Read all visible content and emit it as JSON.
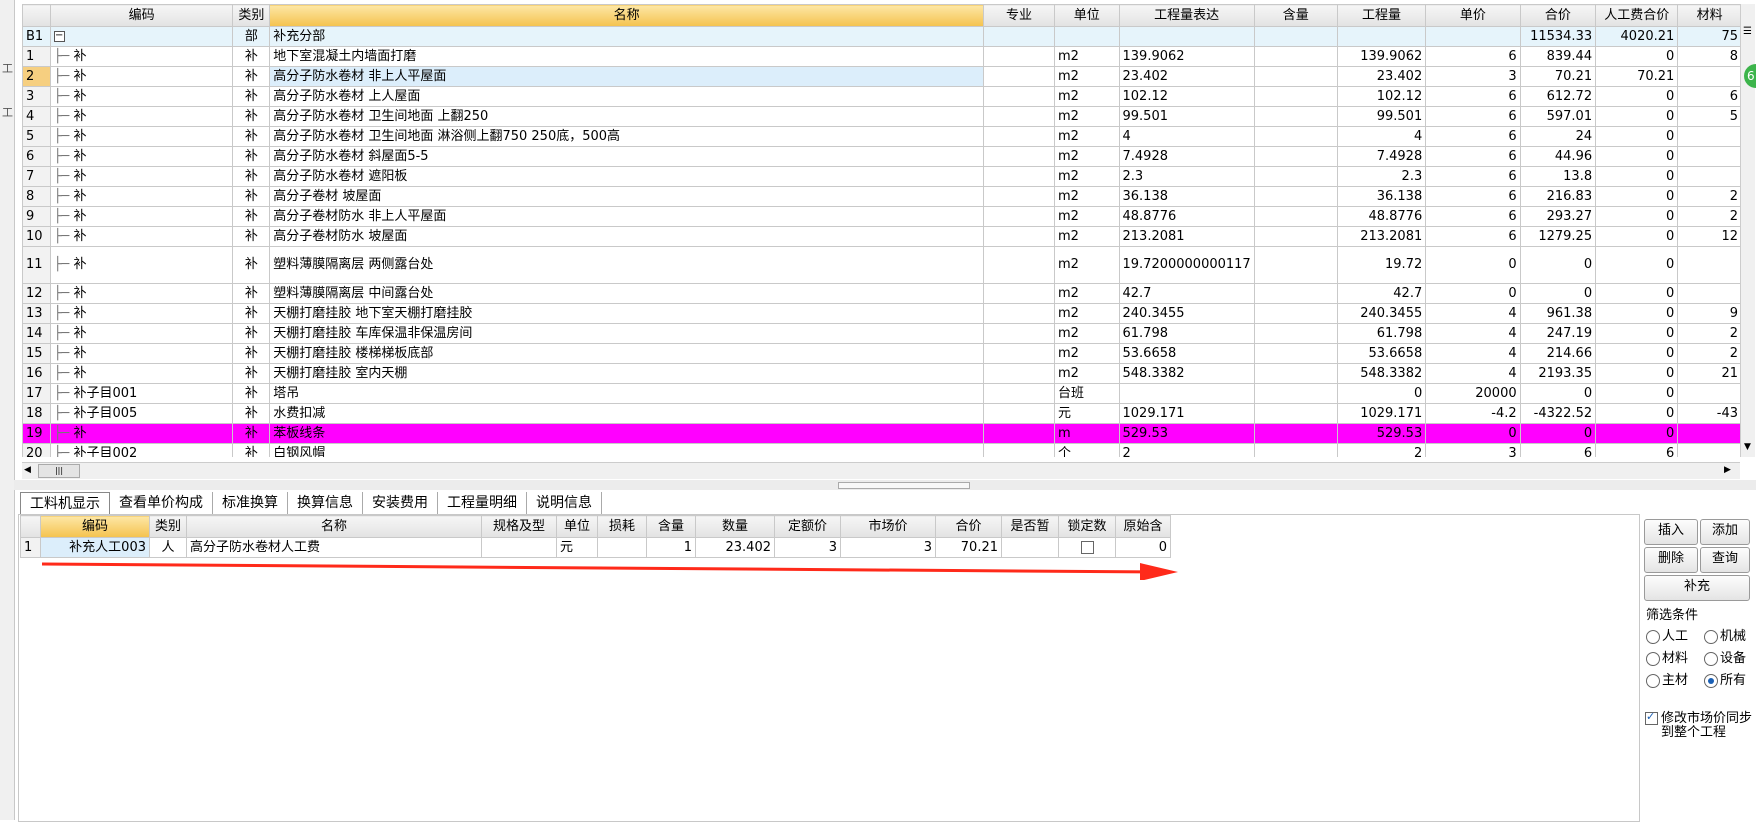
{
  "top_grid": {
    "headers": [
      "",
      "编码",
      "类别",
      "名称",
      "专业",
      "单位",
      "工程量表达",
      "含量",
      "工程量",
      "单价",
      "合价",
      "人工费合价",
      "材料"
    ],
    "rows": [
      {
        "no": "B1",
        "code": "",
        "type": "部",
        "name": "补充分部",
        "major": "",
        "unit": "",
        "expr": "",
        "content": "",
        "qty": "",
        "price": "",
        "total": "11534.33",
        "labor": "4020.21",
        "mat": "75",
        "kind": "bu"
      },
      {
        "no": "1",
        "code": "补",
        "type": "补",
        "name": "地下室混凝土内墙面打磨",
        "major": "",
        "unit": "m2",
        "expr": "139.9062",
        "content": "",
        "qty": "139.9062",
        "price": "6",
        "total": "839.44",
        "labor": "0",
        "mat": "8"
      },
      {
        "no": "2",
        "code": "补",
        "type": "补",
        "name": "高分子防水卷材 非上人平屋面",
        "major": "",
        "unit": "m2",
        "expr": "23.402",
        "content": "",
        "qty": "23.402",
        "price": "3",
        "total": "70.21",
        "labor": "70.21",
        "mat": "",
        "kind": "sel"
      },
      {
        "no": "3",
        "code": "补",
        "type": "补",
        "name": "高分子防水卷材 上人屋面",
        "major": "",
        "unit": "m2",
        "expr": "102.12",
        "content": "",
        "qty": "102.12",
        "price": "6",
        "total": "612.72",
        "labor": "0",
        "mat": "6"
      },
      {
        "no": "4",
        "code": "补",
        "type": "补",
        "name": "高分子防水卷材 卫生间地面 上翻250",
        "major": "",
        "unit": "m2",
        "expr": "99.501",
        "content": "",
        "qty": "99.501",
        "price": "6",
        "total": "597.01",
        "labor": "0",
        "mat": "5"
      },
      {
        "no": "5",
        "code": "补",
        "type": "补",
        "name": "高分子防水卷材 卫生间地面 淋浴侧上翻750 250底，500高",
        "major": "",
        "unit": "m2",
        "expr": "4",
        "content": "",
        "qty": "4",
        "price": "6",
        "total": "24",
        "labor": "0",
        "mat": ""
      },
      {
        "no": "6",
        "code": "补",
        "type": "补",
        "name": "高分子防水卷材 斜屋面5-5",
        "major": "",
        "unit": "m2",
        "expr": "7.4928",
        "content": "",
        "qty": "7.4928",
        "price": "6",
        "total": "44.96",
        "labor": "0",
        "mat": ""
      },
      {
        "no": "7",
        "code": "补",
        "type": "补",
        "name": "高分子防水卷材 遮阳板",
        "major": "",
        "unit": "m2",
        "expr": "2.3",
        "content": "",
        "qty": "2.3",
        "price": "6",
        "total": "13.8",
        "labor": "0",
        "mat": ""
      },
      {
        "no": "8",
        "code": "补",
        "type": "补",
        "name": "高分子卷材 坡屋面",
        "major": "",
        "unit": "m2",
        "expr": "36.138",
        "content": "",
        "qty": "36.138",
        "price": "6",
        "total": "216.83",
        "labor": "0",
        "mat": "2"
      },
      {
        "no": "9",
        "code": "补",
        "type": "补",
        "name": "高分子卷材防水 非上人平屋面",
        "major": "",
        "unit": "m2",
        "expr": "48.8776",
        "content": "",
        "qty": "48.8776",
        "price": "6",
        "total": "293.27",
        "labor": "0",
        "mat": "2"
      },
      {
        "no": "10",
        "code": "补",
        "type": "补",
        "name": "高分子卷材防水 坡屋面",
        "major": "",
        "unit": "m2",
        "expr": "213.2081",
        "content": "",
        "qty": "213.2081",
        "price": "6",
        "total": "1279.25",
        "labor": "0",
        "mat": "12"
      },
      {
        "no": "11",
        "code": "补",
        "type": "补",
        "name": "塑料薄膜隔离层 两侧露台处",
        "major": "",
        "unit": "m2",
        "expr": "19.7200000000117",
        "content": "",
        "qty": "19.72",
        "price": "0",
        "total": "0",
        "labor": "0",
        "mat": "",
        "kind": "tall"
      },
      {
        "no": "12",
        "code": "补",
        "type": "补",
        "name": "塑料薄膜隔离层 中间露台处",
        "major": "",
        "unit": "m2",
        "expr": "42.7",
        "content": "",
        "qty": "42.7",
        "price": "0",
        "total": "0",
        "labor": "0",
        "mat": ""
      },
      {
        "no": "13",
        "code": "补",
        "type": "补",
        "name": "天棚打磨挂胶    地下室天棚打磨挂胶",
        "major": "",
        "unit": "m2",
        "expr": "240.3455",
        "content": "",
        "qty": "240.3455",
        "price": "4",
        "total": "961.38",
        "labor": "0",
        "mat": "9"
      },
      {
        "no": "14",
        "code": "补",
        "type": "补",
        "name": "天棚打磨挂胶 车库保温非保温房间",
        "major": "",
        "unit": "m2",
        "expr": "61.798",
        "content": "",
        "qty": "61.798",
        "price": "4",
        "total": "247.19",
        "labor": "0",
        "mat": "2"
      },
      {
        "no": "15",
        "code": "补",
        "type": "补",
        "name": "天棚打磨挂胶 楼梯梯板底部",
        "major": "",
        "unit": "m2",
        "expr": "53.6658",
        "content": "",
        "qty": "53.6658",
        "price": "4",
        "total": "214.66",
        "labor": "0",
        "mat": "2"
      },
      {
        "no": "16",
        "code": "补",
        "type": "补",
        "name": "天棚打磨挂胶 室内天棚",
        "major": "",
        "unit": "m2",
        "expr": "548.3382",
        "content": "",
        "qty": "548.3382",
        "price": "4",
        "total": "2193.35",
        "labor": "0",
        "mat": "21"
      },
      {
        "no": "17",
        "code": "补子目001",
        "type": "补",
        "name": "塔吊",
        "major": "",
        "unit": "台班",
        "expr": "",
        "content": "",
        "qty": "0",
        "price": "20000",
        "total": "0",
        "labor": "0",
        "mat": ""
      },
      {
        "no": "18",
        "code": "补子目005",
        "type": "补",
        "name": "水费扣减",
        "major": "",
        "unit": "元",
        "expr": "1029.171",
        "content": "",
        "qty": "1029.171",
        "price": "-4.2",
        "total": "-4322.52",
        "labor": "0",
        "mat": "-43"
      },
      {
        "no": "19",
        "code": "补",
        "type": "补",
        "name": "苯板线条",
        "major": "",
        "unit": "m",
        "expr": "529.53",
        "content": "",
        "qty": "529.53",
        "price": "0",
        "total": "0",
        "labor": "0",
        "mat": "",
        "kind": "mag"
      },
      {
        "no": "20",
        "code": "补子目002",
        "type": "补",
        "name": "白钢风帽",
        "major": "",
        "unit": "个",
        "expr": "2",
        "content": "",
        "qty": "2",
        "price": "3",
        "total": "6",
        "labor": "6",
        "mat": ""
      }
    ]
  },
  "tabs": [
    "工料机显示",
    "查看单价构成",
    "标准换算",
    "换算信息",
    "安装费用",
    "工程量明细",
    "说明信息"
  ],
  "bottom_grid": {
    "headers": [
      "",
      "编码",
      "类别",
      "名称",
      "规格及型",
      "单位",
      "损耗",
      "含量",
      "数量",
      "定额价",
      "市场价",
      "合价",
      "是否暂",
      "锁定数",
      "原始含"
    ],
    "rows": [
      {
        "no": "1",
        "code": "补充人工003",
        "type": "人",
        "name": "高分子防水卷材人工费",
        "spec": "",
        "unit": "元",
        "loss": "",
        "content": "1",
        "qty": "23.402",
        "quota": "3",
        "market": "3",
        "total": "70.21",
        "temp": "",
        "locked": false,
        "orig": "0"
      }
    ]
  },
  "right_panel": {
    "insert": "插入",
    "add": "添加",
    "delete": "删除",
    "query": "查询",
    "supplement": "补充",
    "filter_title": "筛选条件",
    "filters": [
      "人工",
      "机械",
      "材料",
      "设备",
      "主材",
      "所有"
    ],
    "filter_selected": "所有",
    "sync_label": "修改市场价同步到整个工程",
    "sync_checked": true
  },
  "badge": "6",
  "colors": {
    "highlight_row": "#ff00ff",
    "name_header": "#f4c24e",
    "selected_row": "#dceefb",
    "arrow": "#ff2a1a"
  }
}
